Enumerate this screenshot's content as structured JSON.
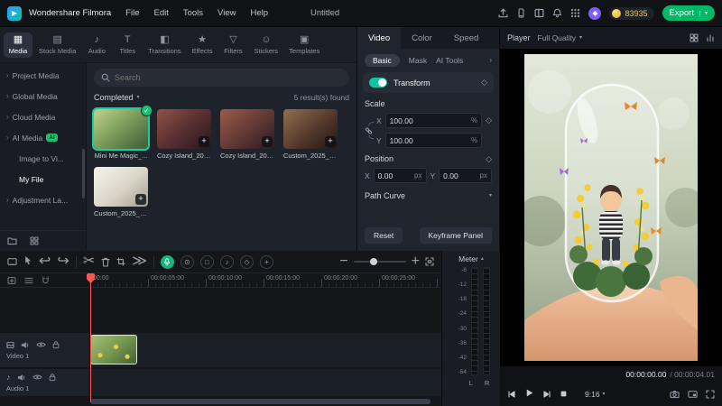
{
  "app": {
    "name": "Wondershare Filmora",
    "project_title": "Untitled"
  },
  "menubar": {
    "items": [
      "File",
      "Edit",
      "Tools",
      "View",
      "Help"
    ]
  },
  "topbar": {
    "coins": "83935",
    "export_label": "Export"
  },
  "colors": {
    "accent_teal": "#15d0a2",
    "export_green": "#00b868",
    "coin_gold": "#f0c95c",
    "playhead_red": "#ff5552",
    "toggle_on": "#12c4a0",
    "ai_badge_green": "#17c46f"
  },
  "media_tabs": [
    {
      "label": "Media"
    },
    {
      "label": "Stock Media"
    },
    {
      "label": "Audio"
    },
    {
      "label": "Titles"
    },
    {
      "label": "Transitions"
    },
    {
      "label": "Effects"
    },
    {
      "label": "Filters"
    },
    {
      "label": "Stickers"
    },
    {
      "label": "Templates"
    }
  ],
  "sidebar": {
    "items": [
      {
        "label": "Project Media"
      },
      {
        "label": "Global Media"
      },
      {
        "label": "Cloud Media"
      },
      {
        "label": "AI Media",
        "badge": "AI"
      },
      {
        "label": "Image to Vi..."
      },
      {
        "label": "My File"
      },
      {
        "label": "Adjustment La..."
      }
    ]
  },
  "media_panel": {
    "search_placeholder": "Search",
    "filter_label": "Completed",
    "results_text": "5 result(s) found",
    "items": [
      {
        "name": "Mini Me Magic_..."
      },
      {
        "name": "Cozy Island_202..."
      },
      {
        "name": "Cozy Island_202..."
      },
      {
        "name": "Custom_2025_0..."
      },
      {
        "name": "Custom_2025_0..."
      }
    ]
  },
  "properties": {
    "tabs": [
      {
        "label": "Video"
      },
      {
        "label": "Color"
      },
      {
        "label": "Speed"
      }
    ],
    "subtabs": [
      {
        "label": "Basic"
      },
      {
        "label": "Mask"
      },
      {
        "label": "AI Tools"
      }
    ],
    "transform_label": "Transform",
    "scale": {
      "label": "Scale",
      "x_label": "X",
      "x_value": "100.00",
      "x_unit": "%",
      "y_label": "Y",
      "y_value": "100.00",
      "y_unit": "%"
    },
    "position": {
      "label": "Position",
      "x_label": "X",
      "x_value": "0.00",
      "x_unit": "px",
      "y_label": "Y",
      "y_value": "0.00",
      "y_unit": "px"
    },
    "path_curve_label": "Path Curve",
    "reset_label": "Reset",
    "keyframe_panel_label": "Keyframe Panel"
  },
  "player": {
    "label": "Player",
    "quality": "Full Quality",
    "timecode_current": "00:00:00.00",
    "timecode_total": "/ 00:00:04.01",
    "ratio": "9:16"
  },
  "timeline": {
    "ruler": [
      "00:00",
      "00:00:05:00",
      "00:00:10:00",
      "00:00:15:00",
      "00:00:20:00",
      "00:00:25:00"
    ],
    "tracks": [
      {
        "name": "Video 1"
      },
      {
        "name": "Audio 1"
      }
    ]
  },
  "meter": {
    "label": "Meter",
    "scale": [
      "-6",
      "-12",
      "-18",
      "-24",
      "-30",
      "-36",
      "-42",
      "-54"
    ],
    "channels": [
      "L",
      "R"
    ]
  }
}
